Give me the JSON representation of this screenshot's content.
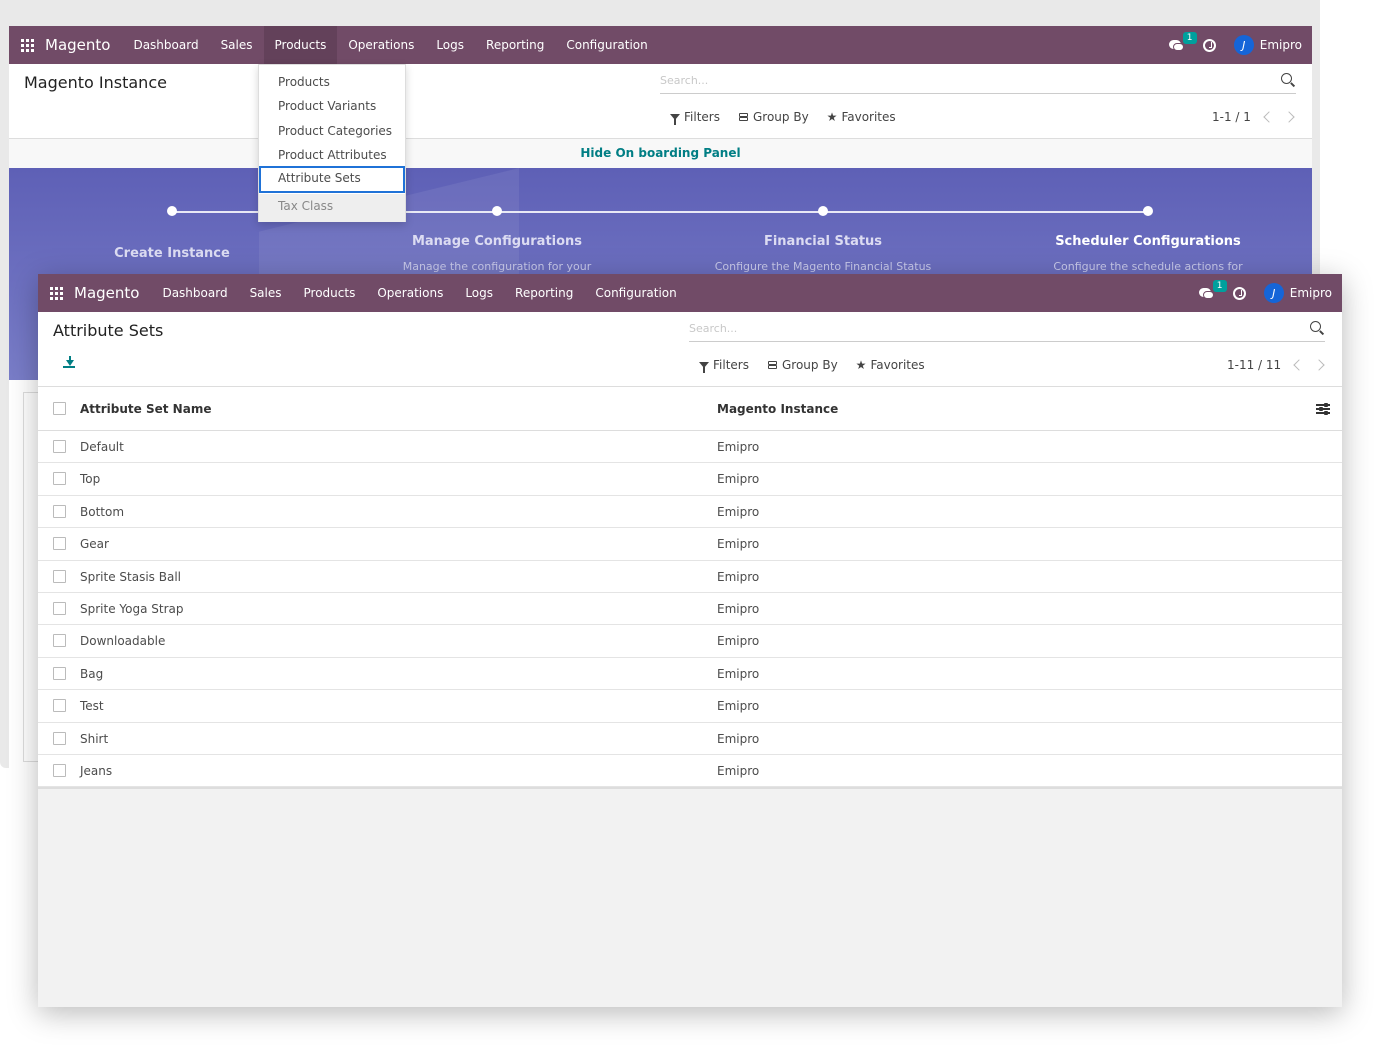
{
  "brand": "Magento",
  "menu": [
    "Dashboard",
    "Sales",
    "Products",
    "Operations",
    "Logs",
    "Reporting",
    "Configuration"
  ],
  "systray": {
    "chat_badge": "1",
    "user_name": "Emipro",
    "user_initial": "J"
  },
  "back": {
    "page_title": "Magento Instance",
    "search_placeholder": "Search...",
    "filters": "Filters",
    "group_by": "Group By",
    "favorites": "Favorites",
    "pager": "1-1 / 1",
    "onboard_link": "Hide On boarding Panel",
    "dropdown": [
      "Products",
      "Product Variants",
      "Product Categories",
      "Product Attributes",
      "Attribute Sets",
      "Tax Class"
    ],
    "steps": [
      {
        "title": "Create Instance",
        "desc": ""
      },
      {
        "title": "Manage Configurations",
        "desc": "Manage the configuration for your"
      },
      {
        "title": "Financial Status",
        "desc": "Configure the Magento Financial Status"
      },
      {
        "title": "Scheduler Configurations",
        "desc": "Configure the schedule actions for"
      }
    ]
  },
  "front": {
    "page_title": "Attribute Sets",
    "search_placeholder": "Search...",
    "filters": "Filters",
    "group_by": "Group By",
    "favorites": "Favorites",
    "pager": "1-11 / 11",
    "columns": [
      "Attribute Set Name",
      "Magento Instance"
    ],
    "rows": [
      [
        "Default",
        "Emipro"
      ],
      [
        "Top",
        "Emipro"
      ],
      [
        "Bottom",
        "Emipro"
      ],
      [
        "Gear",
        "Emipro"
      ],
      [
        "Sprite Stasis Ball",
        "Emipro"
      ],
      [
        "Sprite Yoga Strap",
        "Emipro"
      ],
      [
        "Downloadable",
        "Emipro"
      ],
      [
        "Bag",
        "Emipro"
      ],
      [
        "Test",
        "Emipro"
      ],
      [
        "Shirt",
        "Emipro"
      ],
      [
        "Jeans",
        "Emipro"
      ]
    ]
  },
  "colors": {
    "navbar": "#714b67",
    "accent": "#017e84",
    "banner": "#6a6cbf",
    "badge": "#00a09d"
  }
}
